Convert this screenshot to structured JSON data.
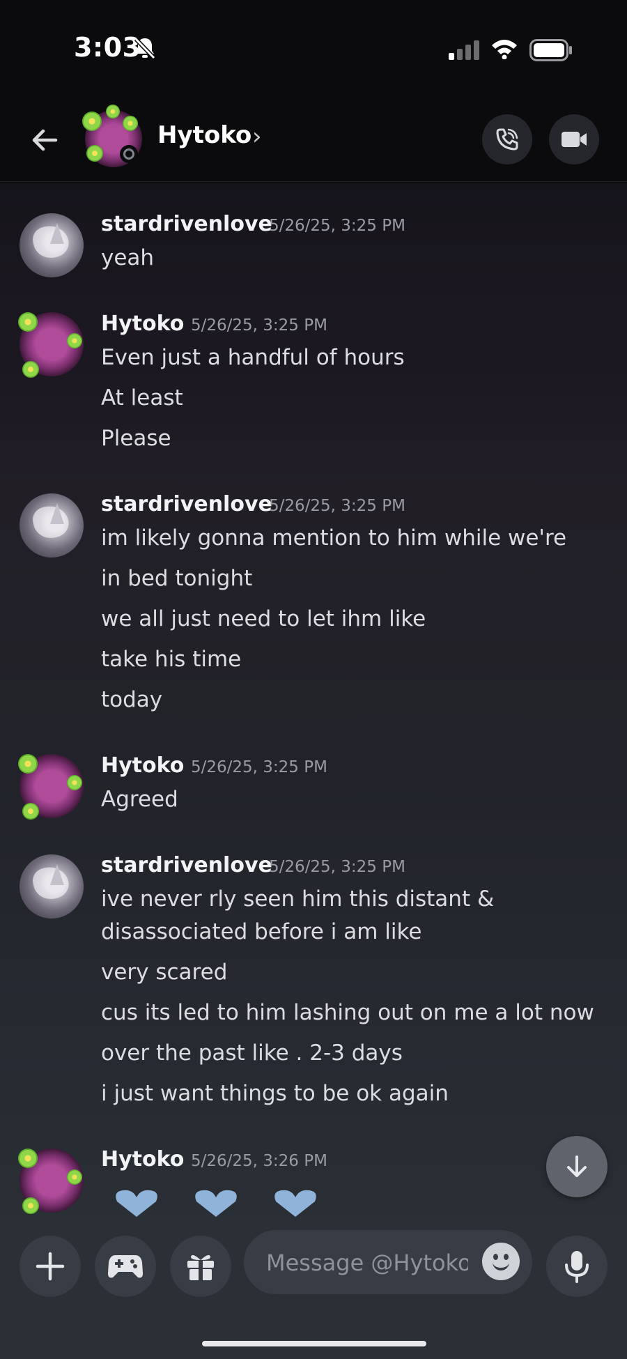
{
  "status_bar": {
    "time": "3:03"
  },
  "header": {
    "title": "Hytoko",
    "chevron": "›"
  },
  "messages": [
    {
      "author": "stardrivenlove",
      "timestamp": "5/26/25, 3:25 PM",
      "lines": [
        "yeah"
      ]
    },
    {
      "author": "Hytoko",
      "timestamp": "5/26/25, 3:25 PM",
      "lines": [
        "Even just a handful of hours",
        "At least",
        "Please"
      ]
    },
    {
      "author": "stardrivenlove",
      "timestamp": "5/26/25, 3:25 PM",
      "lines": [
        "im likely gonna mention to him while we're",
        "in bed tonight",
        "we all just need to let ihm like",
        "take his time",
        "today"
      ]
    },
    {
      "author": "Hytoko",
      "timestamp": "5/26/25, 3:25 PM",
      "lines": [
        "Agreed"
      ]
    },
    {
      "author": "stardrivenlove",
      "timestamp": "5/26/25, 3:25 PM",
      "lines": [
        "ive never rly seen him this distant &",
        "disassociated before i am like",
        "very scared",
        "cus its led to him lashing out on me a lot now",
        "over the past like . 2-3 days",
        "i just want things to be ok again"
      ]
    },
    {
      "author": "Hytoko",
      "timestamp": "5/26/25, 3:26 PM",
      "lines": []
    }
  ],
  "composer": {
    "placeholder": "Message @Hytoko"
  },
  "icons": {
    "back": "arrow-left-icon",
    "call": "phone-call-icon",
    "video": "video-camera-icon",
    "add": "plus-icon",
    "activities": "gamepad-icon",
    "gift": "gift-icon",
    "emoji": "emoji-icon",
    "mic": "microphone-icon",
    "jump": "arrow-down-icon",
    "hearts": "blue-heart-emoji"
  },
  "colors": {
    "background_top": "#0b0b0e",
    "background_bottom": "#2a2f35",
    "composer": "#2b3036",
    "heart": "#8fb3d9"
  }
}
